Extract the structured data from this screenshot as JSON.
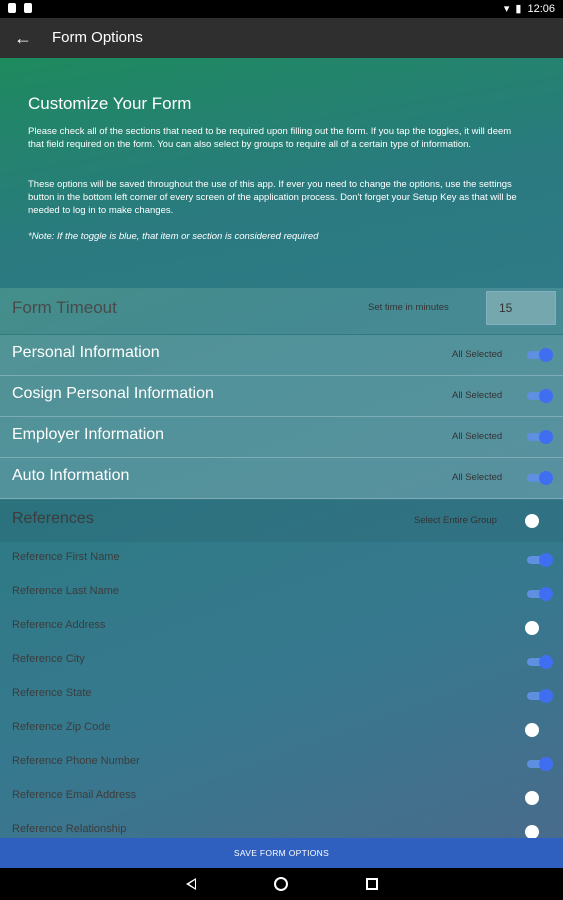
{
  "status": {
    "time": "12:06"
  },
  "appbar": {
    "title": "Form Options"
  },
  "intro": {
    "heading": "Customize Your Form",
    "p1": "Please check all of the sections that need to be required upon filling out the form. If you tap the toggles, it will deem that field required on the form. You can also select by groups to require all of a certain type of information.",
    "p2": "These options will be saved throughout the use of this app. If ever you need to change the options, use the settings button in the bottom left corner of every screen of the application process. Don't forget your Setup Key as that will be needed to log in to make changes.",
    "note": "*Note: If the toggle is blue, that item or section is considered required"
  },
  "timeout": {
    "label": "Form Timeout",
    "hint": "Set time in minutes",
    "value": "15"
  },
  "sections": [
    {
      "label": "Personal Information",
      "tag": "All Selected",
      "on": true
    },
    {
      "label": "Cosign Personal Information",
      "tag": "All Selected",
      "on": true
    },
    {
      "label": "Employer Information",
      "tag": "All Selected",
      "on": true
    },
    {
      "label": "Auto Information",
      "tag": "All Selected",
      "on": true
    }
  ],
  "references": {
    "label": "References",
    "tag": "Select Entire Group",
    "group_on": false,
    "items": [
      {
        "label": "Reference First Name",
        "on": true
      },
      {
        "label": "Reference Last Name",
        "on": true
      },
      {
        "label": "Reference Address",
        "on": false
      },
      {
        "label": "Reference City",
        "on": true
      },
      {
        "label": "Reference State",
        "on": true
      },
      {
        "label": "Reference Zip Code",
        "on": false
      },
      {
        "label": "Reference Phone Number",
        "on": true
      },
      {
        "label": "Reference Email Address",
        "on": false
      },
      {
        "label": "Reference Relationship",
        "on": false
      }
    ]
  },
  "save": {
    "label": "SAVE FORM OPTIONS"
  },
  "colors": {
    "toggle_on": "#3f6ff0",
    "save_bar": "#2f5fbf",
    "appbar": "#2f2f2f"
  }
}
